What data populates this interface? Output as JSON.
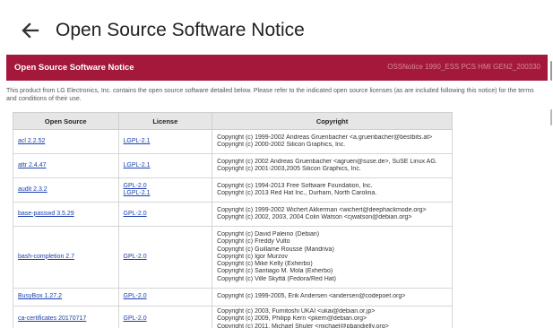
{
  "appbar": {
    "title": "Open Source Software Notice",
    "back_icon": "arrow-left-icon"
  },
  "banner": {
    "title": "Open Source Software Notice",
    "doc_id": "OSSNotice 1990_ESS PCS HMI GEN2_200330"
  },
  "intro": "This product from LG Electronics, Inc. contains the open source software detailed below. Please refer to the indicated open source licenses (as are included following this notice) for the terms and conditions of their use.",
  "table": {
    "headers": [
      "Open Source",
      "License",
      "Copyright"
    ],
    "rows": [
      {
        "name": "acl 2.2.52",
        "licenses": [
          "LGPL-2.1"
        ],
        "copyright": [
          "Copyright (c) 1999-2002 Andreas Gruenbacher <a.gruenbacher@bestbits.at>",
          "Copyright (c) 2000-2002 Silicon Graphics, Inc."
        ]
      },
      {
        "name": "attr 2.4.47",
        "licenses": [
          "LGPL-2.1"
        ],
        "copyright": [
          "Copyright (c) 2002 Andreas Gruenbacher <agruen@suse.de>, SuSE Linux AG.",
          "Copyright (c) 2001-2003,2005 Silicon Graphics, Inc."
        ]
      },
      {
        "name": "audit 2.3.2",
        "licenses": [
          "GPL-2.0",
          "LGPL-2.1"
        ],
        "copyright": [
          "Copyright (c) 1994-2013 Free Software Foundation, Inc.",
          "Copyright (c) 2013 Red Hat Inc., Durham, North Carolina."
        ]
      },
      {
        "name": "base-passwd 3.5.29",
        "licenses": [
          "GPL-2.0"
        ],
        "copyright": [
          "Copyright (c) 1999-2002 Wichert Akkerman <wichert@deephackmode.org>",
          "Copyright (c) 2002, 2003, 2004 Colin Watson <cjwatson@debian.org>"
        ]
      },
      {
        "name": "bash-completion 2.7",
        "licenses": [
          "GPL-2.0"
        ],
        "copyright": [
          "Copyright (c) David Paleino (Debian)",
          "Copyright (c) Freddy Vulto",
          "Copyright (c) Guillame Rousse (Mandriva)",
          "Copyright (c) Igor Murzov",
          "Copyright (c) Mike Kelly (Exherbo)",
          "Copyright (c) Santiago M. Mola (Exherbo)",
          "Copyright (c) Ville Skyttä (Fedora/Red Hat)"
        ]
      },
      {
        "name": "BusyBox 1.27.2",
        "licenses": [
          "GPL-2.0"
        ],
        "copyright": [
          "Copyright (c) 1999-2005, Erik Andersen <andersen@codepoet.org>"
        ]
      },
      {
        "name": "ca-certificates 20170717",
        "licenses": [
          "GPL-2.0"
        ],
        "copyright": [
          "Copyright (c) 2003, Fumitoshi UKAI <ukai@debian.or.jp>",
          "Copyright (c) 2009, Philipp Kern <pkern@debian.org>",
          "Copyright (c) 2011, Michael Shuler <michael@pbandjelly.org>"
        ]
      }
    ]
  },
  "colors": {
    "banner": "#a4183c",
    "link": "#1a3fb0",
    "header_bg": "#e6e6e6"
  }
}
